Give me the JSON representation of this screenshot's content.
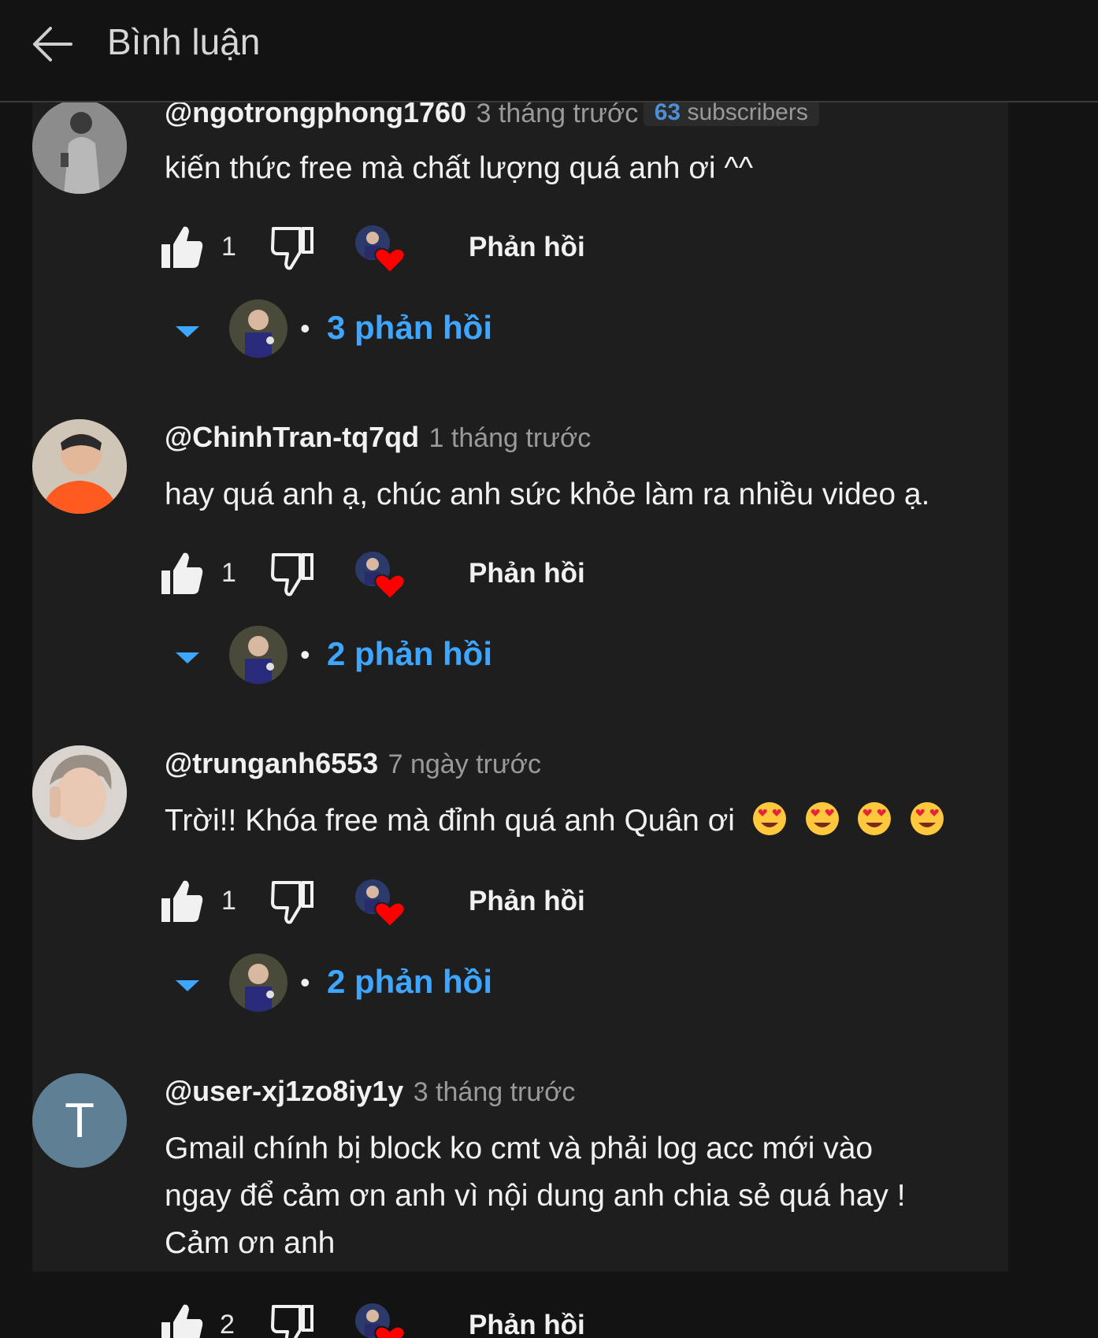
{
  "header": {
    "title": "Bình luận"
  },
  "comments": [
    {
      "author": "@ngotrongphong1760",
      "time": "3 tháng trước",
      "subscribers_count": "63",
      "subscribers_label": "subscribers",
      "text": "kiến thức free mà chất lượng quá anh ơi ^^",
      "likes": "1",
      "reply_label": "Phản hồi",
      "replies": "3 phản hồi"
    },
    {
      "author": "@ChinhTran-tq7qd",
      "time": "1 tháng trước",
      "text": "hay quá anh ạ, chúc anh sức khỏe làm ra nhiều video ạ.",
      "likes": "1",
      "reply_label": "Phản hồi",
      "replies": "2 phản hồi"
    },
    {
      "author": "@trunganh6553",
      "time": "7 ngày trước",
      "text": "Trời!! Khóa free mà đỉnh quá anh Quân ơi",
      "emoji": "heart-eyes",
      "likes": "1",
      "reply_label": "Phản hồi",
      "replies": "2 phản hồi"
    },
    {
      "author": "@user-xj1zo8iy1y",
      "time": "3 tháng trước",
      "avatar_letter": "T",
      "text_lines": [
        "Gmail chính bị block ko cmt và phải log acc mới vào",
        "ngay để cảm ơn anh vì nội dung anh chia sẻ quá hay !",
        "Cảm ơn anh"
      ],
      "likes": "2",
      "reply_label": "Phản hồi"
    }
  ],
  "colors": {
    "accent": "#3ea6ff",
    "background": "#131313",
    "panel": "#1e1e1e",
    "heart": "#ff0000"
  }
}
